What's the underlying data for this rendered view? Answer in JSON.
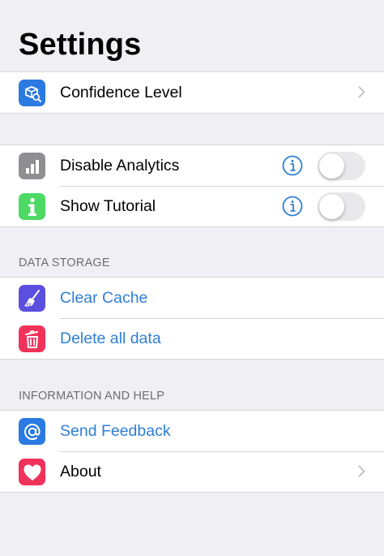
{
  "header": {
    "title": "Settings"
  },
  "groups": {
    "confidence": {
      "label": "Confidence Level",
      "icon": "cube-search-icon",
      "icon_color": "#2a7ae2"
    },
    "toggles": {
      "analytics": {
        "label": "Disable Analytics",
        "icon": "bar-chart-icon",
        "icon_color": "#8e8e93",
        "enabled": false
      },
      "tutorial": {
        "label": "Show Tutorial",
        "icon": "info-icon",
        "icon_color": "#4cd964",
        "enabled": false
      }
    },
    "data_storage": {
      "header": "DATA STORAGE",
      "clear_cache": {
        "label": "Clear Cache",
        "icon": "broom-icon",
        "icon_color": "#5b4fe0"
      },
      "delete_all": {
        "label": "Delete all data",
        "icon": "trash-icon",
        "icon_color": "#f0325a"
      }
    },
    "info_help": {
      "header": "INFORMATION AND HELP",
      "feedback": {
        "label": "Send Feedback",
        "icon": "at-sign-icon",
        "icon_color": "#2a7ae2"
      },
      "about": {
        "label": "About",
        "icon": "heart-icon",
        "icon_color": "#f0325a"
      }
    }
  },
  "colors": {
    "link": "#2f7fd6",
    "background": "#efeff4",
    "separator": "#d6d6da",
    "section_header": "#6d6d72",
    "toggle_off": "#e9e9eb"
  }
}
